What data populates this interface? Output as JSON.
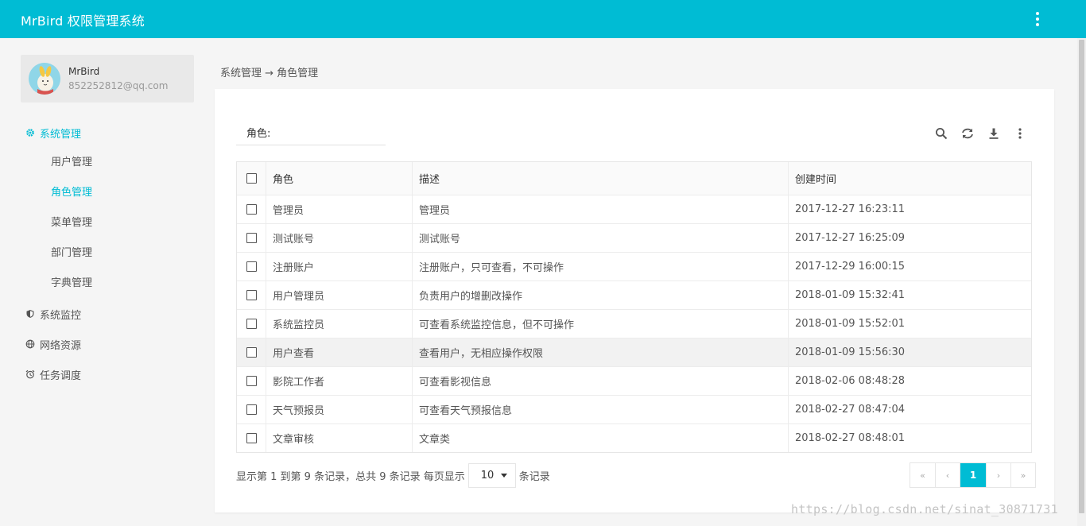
{
  "app": {
    "title": "MrBird 权限管理系统"
  },
  "colors": {
    "accent": "#00bcd4",
    "background": "#f5f5f5",
    "card": "#ffffff"
  },
  "user": {
    "name": "MrBird",
    "email": "852252812@qq.com"
  },
  "sidebar": {
    "groups": [
      {
        "label": "系统管理",
        "icon": "gear-icon",
        "active": true
      },
      {
        "label": "系统监控",
        "icon": "shield-icon",
        "active": false
      },
      {
        "label": "网络资源",
        "icon": "globe-icon",
        "active": false
      },
      {
        "label": "任务调度",
        "icon": "alarm-clock-icon",
        "active": false
      }
    ],
    "subitems": [
      {
        "label": "用户管理",
        "active": false
      },
      {
        "label": "角色管理",
        "active": true
      },
      {
        "label": "菜单管理",
        "active": false
      },
      {
        "label": "部门管理",
        "active": false
      },
      {
        "label": "字典管理",
        "active": false
      }
    ]
  },
  "breadcrumb": "系统管理 → 角色管理",
  "filter": {
    "label": "角色:",
    "value": ""
  },
  "toolbar": [
    "search-icon",
    "refresh-icon",
    "download-icon",
    "more-vertical-icon"
  ],
  "table": {
    "columns": [
      "角色",
      "描述",
      "创建时间"
    ],
    "rows": [
      {
        "role": "管理员",
        "desc": "管理员",
        "time": "2017-12-27 16:23:11"
      },
      {
        "role": "测试账号",
        "desc": "测试账号",
        "time": "2017-12-27 16:25:09"
      },
      {
        "role": "注册账户",
        "desc": "注册账户，只可查看，不可操作",
        "time": "2017-12-29 16:00:15"
      },
      {
        "role": "用户管理员",
        "desc": "负责用户的增删改操作",
        "time": "2018-01-09 15:32:41"
      },
      {
        "role": "系统监控员",
        "desc": "可查看系统监控信息，但不可操作",
        "time": "2018-01-09 15:52:01"
      },
      {
        "role": "用户查看",
        "desc": "查看用户，无相应操作权限",
        "time": "2018-01-09 15:56:30"
      },
      {
        "role": "影院工作者",
        "desc": "可查看影视信息",
        "time": "2018-02-06 08:48:28"
      },
      {
        "role": "天气预报员",
        "desc": "可查看天气预报信息",
        "time": "2018-02-27 08:47:04"
      },
      {
        "role": "文章审核",
        "desc": "文章类",
        "time": "2018-02-27 08:48:01"
      }
    ]
  },
  "pager": {
    "summary": "显示第 1 到第 9 条记录，总共 9 条记录 每页显示",
    "page_size": "10",
    "suffix": "条记录",
    "buttons": [
      "«",
      "‹",
      "1",
      "›",
      "»"
    ],
    "current_page": "1"
  },
  "watermark": "https://blog.csdn.net/sinat_30871731"
}
